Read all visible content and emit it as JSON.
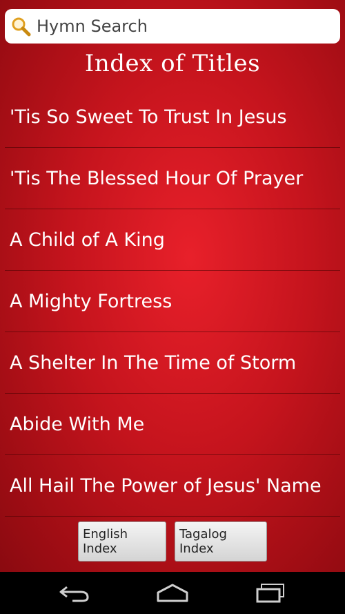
{
  "search": {
    "placeholder": "Hymn Search"
  },
  "page": {
    "title": "Index of Titles"
  },
  "hymns": [
    "'Tis So Sweet To Trust In Jesus",
    "'Tis The Blessed Hour Of Prayer",
    "A Child of A King",
    "A Mighty Fortress",
    "A Shelter In The Time of Storm",
    "Abide With Me",
    "All Hail The Power of Jesus' Name"
  ],
  "buttons": {
    "english": "English Index",
    "tagalog": "Tagalog Index"
  },
  "icons": {
    "search": "magnifying-glass",
    "nav_back": "back-arrow",
    "nav_home": "home",
    "nav_recents": "recent-apps"
  },
  "colors": {
    "background": "#c5141d",
    "text": "#ffffff",
    "search_icon": "#e8a317"
  }
}
